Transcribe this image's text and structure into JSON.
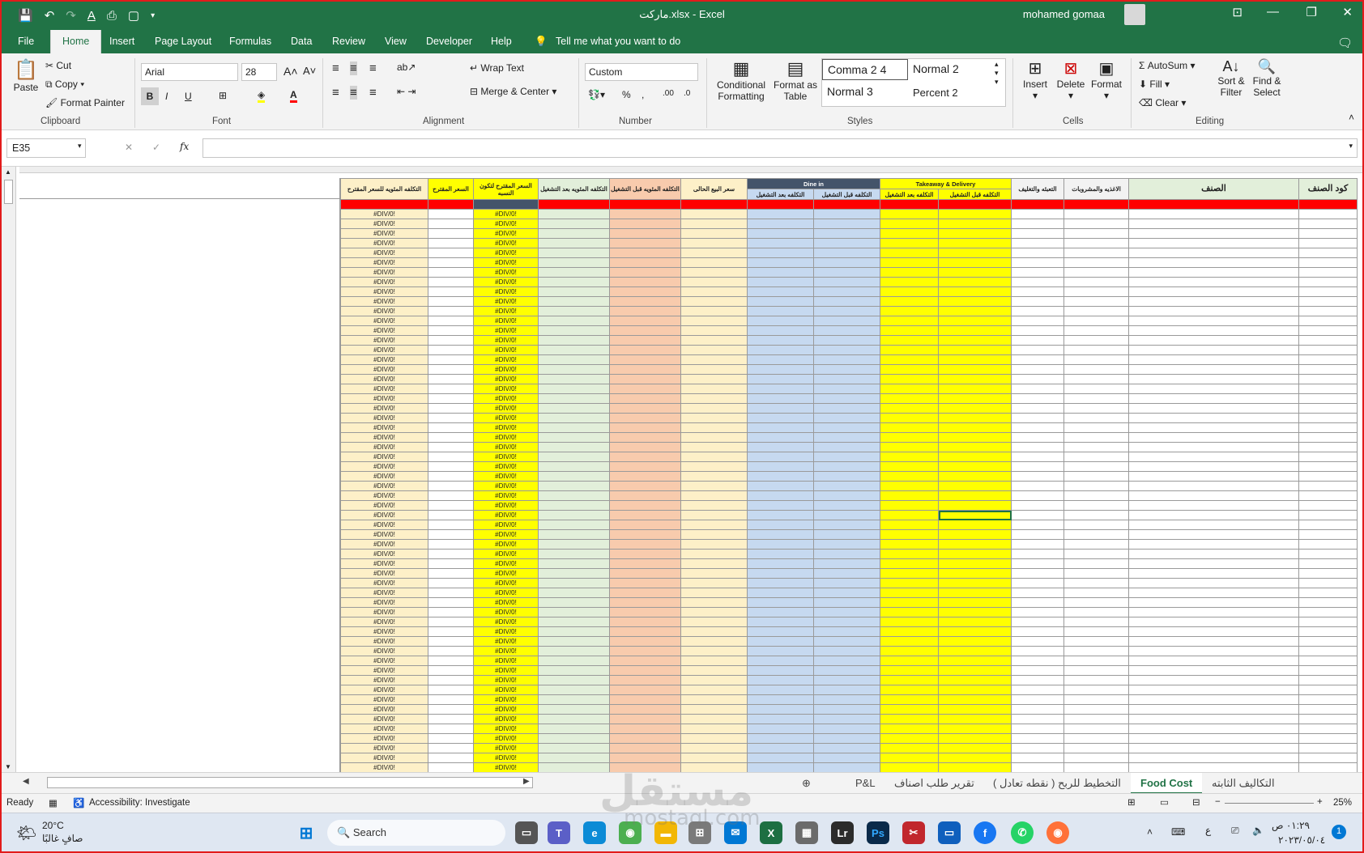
{
  "window": {
    "title": "ماركت.xlsx  -  Excel",
    "user": "mohamed gomaa"
  },
  "tabs": [
    "File",
    "Home",
    "Insert",
    "Page Layout",
    "Formulas",
    "Data",
    "Review",
    "View",
    "Developer",
    "Help"
  ],
  "tell_me": "Tell me what you want to do",
  "ribbon": {
    "clipboard": {
      "paste": "Paste",
      "cut": "Cut",
      "copy": "Copy",
      "format_painter": "Format Painter",
      "label": "Clipboard"
    },
    "font": {
      "name": "Arial",
      "size": "28",
      "label": "Font"
    },
    "alignment": {
      "wrap": "Wrap Text",
      "merge": "Merge & Center",
      "label": "Alignment"
    },
    "number": {
      "format": "Custom",
      "label": "Number"
    },
    "styles": {
      "conditional_1": "Conditional",
      "conditional_2": "Formatting",
      "format_as_1": "Format as",
      "format_as_2": "Table",
      "gallery": [
        "Comma 2 4",
        "Normal 2",
        "Normal 3",
        "Percent 2"
      ],
      "label": "Styles"
    },
    "cells": {
      "insert": "Insert",
      "delete": "Delete",
      "format": "Format",
      "label": "Cells"
    },
    "editing": {
      "autosum": "AutoSum",
      "fill": "Fill",
      "clear": "Clear",
      "sort_1": "Sort &",
      "sort_2": "Filter",
      "find_1": "Find &",
      "find_2": "Select",
      "label": "Editing"
    }
  },
  "formula_bar": {
    "name_box": "E35",
    "fx": "fx",
    "value": ""
  },
  "headers": {
    "h1": "التكلفه المئويه للسعر المقترح",
    "h2": "السعر المقترح",
    "h3": "السعر المقترح لتكون النسبه",
    "h4": "التكلفه المئويه بعد التشغيل",
    "h5": "التكلفه المئويه قبل التشغيل",
    "h6": "سعر البيع الحالى",
    "dine_in": "Dine in",
    "h7": "التكلفه بعد التشغيل",
    "h8": "التكلفه قبل التشغيل",
    "takeaway": "Takeaway & Delivery",
    "h9": "التكلفه بعد التشغيل",
    "h10": "التكلفه قبل التشغيل",
    "h11": "التعبئه والتغليف",
    "h12": "الاغذيه والمشروبات",
    "h13": "الصنف",
    "h14": "كود الصنف"
  },
  "error_value": "#DIV/0!",
  "sheets": [
    "P&L",
    "تقرير طلب اصناف",
    "التخطيط للربح ( نقطه تعادل )",
    "Food Cost",
    "التكاليف الثابته"
  ],
  "active_sheet": "Food Cost",
  "status": {
    "ready": "Ready",
    "accessibility": "Accessibility: Investigate",
    "zoom": "25%"
  },
  "taskbar": {
    "temp": "20°C",
    "weather": "صافٍ غالبًا",
    "search": "Search",
    "time": "٠١:٢٩ ص",
    "date": "٢٠٢٣/٠٥/٠٤",
    "lang": "ع"
  },
  "watermark": {
    "ar": "مستقل",
    "en": "mostaql.com"
  },
  "colors": {
    "excel_green": "#217346",
    "yellow": "#ffff00",
    "red": "#ff0000"
  }
}
